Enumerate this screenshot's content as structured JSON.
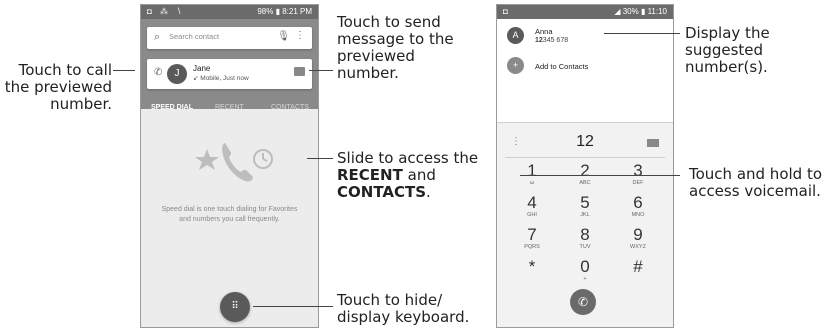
{
  "left_phone": {
    "status": {
      "left_icons": "◘ ⁂ ∖",
      "right": "98% ▮ 8:21 PM"
    },
    "search": {
      "placeholder": "Search contact"
    },
    "preview": {
      "avatar_letter": "J",
      "name": "Jane",
      "detail": "↙ Mobile, Just now"
    },
    "tabs": [
      "SPEED DIAL",
      "RECENT",
      "CONTACTS"
    ],
    "speed_dial_text": "Speed dial is one touch dialing for Favorites and numbers you call frequently."
  },
  "right_phone": {
    "status": {
      "left_icons": "◘",
      "right": "◢ 30% ▮ 11:10"
    },
    "suggestion": {
      "avatar_letter": "A",
      "name": "Anna",
      "number_bold": "12",
      "number_rest": "345 678"
    },
    "add_to_contacts": "Add to Contacts",
    "typed_number": "12",
    "keys": [
      {
        "d": "1",
        "s": "ω"
      },
      {
        "d": "2",
        "s": "ABC"
      },
      {
        "d": "3",
        "s": "DEF"
      },
      {
        "d": "4",
        "s": "GHI"
      },
      {
        "d": "5",
        "s": "JKL"
      },
      {
        "d": "6",
        "s": "MNO"
      },
      {
        "d": "7",
        "s": "PQRS"
      },
      {
        "d": "8",
        "s": "TUV"
      },
      {
        "d": "9",
        "s": "WXYZ"
      },
      {
        "d": "*",
        "s": ""
      },
      {
        "d": "0",
        "s": "+"
      },
      {
        "d": "#",
        "s": ""
      }
    ]
  },
  "callouts": {
    "call_previewed": "Touch to call the previewed number.",
    "send_message": "Touch to send message to the previewed number.",
    "slide_access_pre": "Slide to access the",
    "slide_recent": "RECENT",
    "slide_and": "and",
    "slide_contacts": "CONTACTS",
    "slide_period": ".",
    "hide_keyboard": "Touch to hide/ display keyboard.",
    "suggested_numbers": "Display the suggested number(s).",
    "voicemail": "Touch and hold to access voicemail."
  },
  "icons": {
    "search": "search-icon",
    "mic": "microphone-icon",
    "menu": "overflow-menu-icon",
    "call": "phone-icon",
    "message": "message-icon",
    "dialpad": "dialpad-icon",
    "add_contact": "add-contact-icon",
    "backspace": "backspace-icon"
  }
}
